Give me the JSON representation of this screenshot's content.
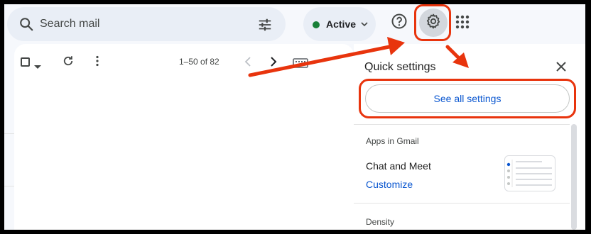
{
  "search": {
    "placeholder": "Search mail"
  },
  "status": {
    "label": "Active",
    "color": "#188038"
  },
  "toolbar": {
    "count": "1–50 of 82"
  },
  "quick_settings": {
    "title": "Quick settings",
    "see_all_label": "See all settings",
    "apps_heading": "Apps in Gmail",
    "chat_meet_label": "Chat and Meet",
    "customize_label": "Customize",
    "density_heading": "Density"
  },
  "icons": {
    "search": "search-icon",
    "tune": "tune-icon",
    "help": "help-icon",
    "settings": "gear-icon",
    "apps": "apps-grid-icon",
    "refresh": "refresh-icon",
    "more": "more-vert-icon",
    "prev": "chevron-left-icon",
    "next": "chevron-right-icon",
    "close": "close-icon"
  },
  "colors": {
    "accent_blue": "#0b57d0",
    "annotation_red": "#e8340d"
  }
}
